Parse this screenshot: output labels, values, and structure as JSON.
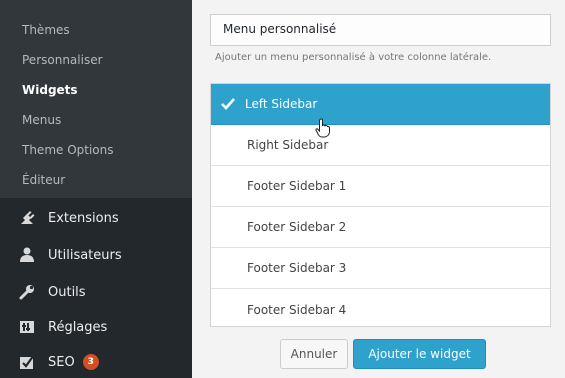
{
  "sidebar": {
    "submenu": [
      {
        "label": "Thèmes",
        "active": false
      },
      {
        "label": "Personnaliser",
        "active": false
      },
      {
        "label": "Widgets",
        "active": true
      },
      {
        "label": "Menus",
        "active": false
      },
      {
        "label": "Theme Options",
        "active": false
      },
      {
        "label": "Éditeur",
        "active": false
      }
    ],
    "menu": [
      {
        "label": "Extensions",
        "icon": "plugin-icon"
      },
      {
        "label": "Utilisateurs",
        "icon": "users-icon"
      },
      {
        "label": "Outils",
        "icon": "wrench-icon"
      },
      {
        "label": "Réglages",
        "icon": "settings-icon"
      },
      {
        "label": "SEO",
        "icon": "seo-icon",
        "badge": "3"
      }
    ]
  },
  "widget": {
    "title": "Menu personnalisé",
    "description": "Ajouter un menu personnalisé à votre colonne latérale.",
    "options": [
      {
        "label": "Left Sidebar",
        "selected": true
      },
      {
        "label": "Right Sidebar",
        "selected": false
      },
      {
        "label": "Footer Sidebar 1",
        "selected": false
      },
      {
        "label": "Footer Sidebar 2",
        "selected": false
      },
      {
        "label": "Footer Sidebar 3",
        "selected": false
      },
      {
        "label": "Footer Sidebar 4",
        "selected": false
      }
    ],
    "cancel_label": "Annuler",
    "add_label": "Ajouter le widget"
  },
  "colors": {
    "sidebar_bg": "#23282d",
    "submenu_bg": "#32373c",
    "accent": "#2ea2cc",
    "badge": "#d54e21"
  }
}
